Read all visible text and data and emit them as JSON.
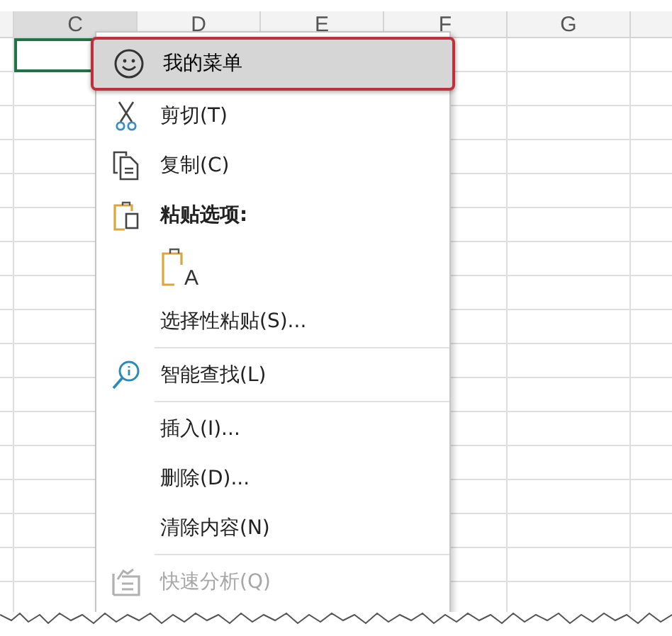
{
  "columns": [
    {
      "label": "C",
      "selected": true
    },
    {
      "label": "D",
      "selected": false
    },
    {
      "label": "E",
      "selected": false
    },
    {
      "label": "F",
      "selected": false
    },
    {
      "label": "G",
      "selected": false
    }
  ],
  "context_menu": {
    "items": [
      {
        "kind": "item",
        "label": "我的菜单",
        "selected": true,
        "disabled": false
      },
      {
        "kind": "item",
        "label": "剪切(T)",
        "selected": false,
        "disabled": false
      },
      {
        "kind": "item",
        "label": "复制(C)",
        "selected": false,
        "disabled": false
      },
      {
        "kind": "header",
        "label": "粘贴选项:"
      },
      {
        "kind": "paste-option",
        "label": "A"
      },
      {
        "kind": "item",
        "label": "选择性粘贴(S)...",
        "selected": false,
        "disabled": false
      },
      {
        "kind": "separator"
      },
      {
        "kind": "item",
        "label": "智能查找(L)",
        "selected": false,
        "disabled": false
      },
      {
        "kind": "separator"
      },
      {
        "kind": "item",
        "label": "插入(I)...",
        "selected": false,
        "disabled": false
      },
      {
        "kind": "item",
        "label": "删除(D)...",
        "selected": false,
        "disabled": false
      },
      {
        "kind": "item",
        "label": "清除内容(N)",
        "selected": false,
        "disabled": false
      },
      {
        "kind": "separator"
      },
      {
        "kind": "item",
        "label": "快速分析(Q)",
        "selected": false,
        "disabled": true
      }
    ]
  }
}
